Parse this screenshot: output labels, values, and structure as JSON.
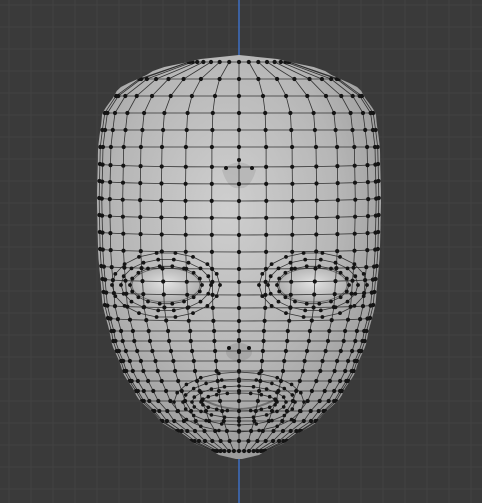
{
  "viewport": {
    "background_color": "#3a3a3a",
    "grid_color": "#444444",
    "axis_z_color": "#3d6ec2"
  },
  "mesh": {
    "object": "head-mesh",
    "mode": "edit",
    "surface_color": "#b9b9b9",
    "wire_color": "#2a2a2a",
    "vertex_color": "#141414"
  }
}
